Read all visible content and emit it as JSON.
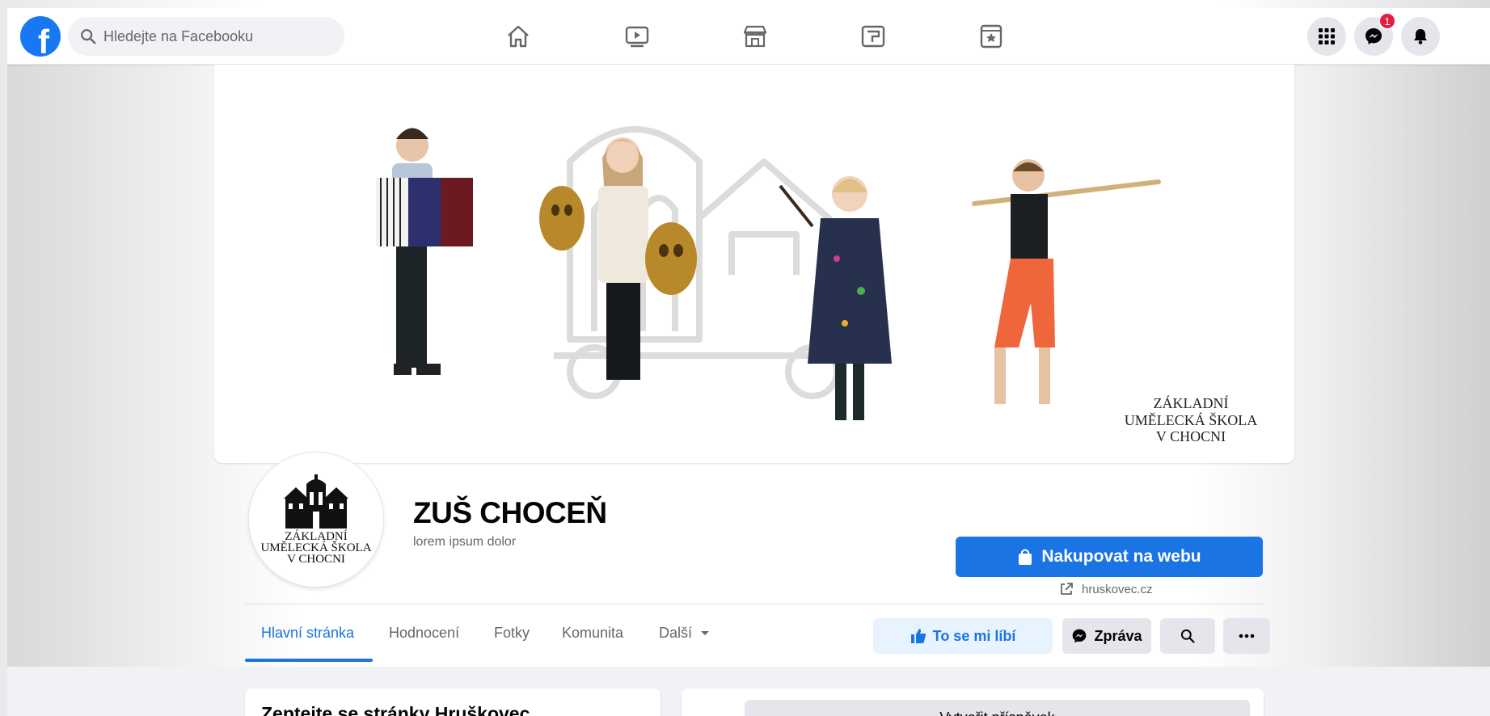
{
  "topbar": {
    "logo_icon": "facebook-logo-icon",
    "logo_letter": "f",
    "search_placeholder": "Hledejte na Facebooku",
    "nav_icons": [
      "home-icon",
      "watch-icon",
      "marketplace-icon",
      "groups-icon",
      "gaming-icon"
    ],
    "right_icons": [
      "menu-grid-icon",
      "messenger-icon",
      "notifications-bell-icon"
    ],
    "messenger_badge": "1"
  },
  "cover": {
    "logo_lines": [
      "ZÁKLADNÍ",
      "UMĚLECKÁ ŠKOLA",
      "V CHOCNI"
    ]
  },
  "profile": {
    "avatar_lines": [
      "ZÁKLADNÍ",
      "UMĚLECKÁ ŠKOLA",
      "V CHOCNI"
    ],
    "name": "ZUŠ CHOCEŇ",
    "subtitle": "lorem ipsum dolor",
    "shop_button": "Nakupovat na webu",
    "website": "hruskovec.cz"
  },
  "tabs": [
    {
      "label": "Hlavní stránka",
      "active": true
    },
    {
      "label": "Hodnocení",
      "active": false
    },
    {
      "label": "Fotky",
      "active": false
    },
    {
      "label": "Komunita",
      "active": false
    },
    {
      "label": "Další",
      "active": false
    }
  ],
  "actions": {
    "like": "To se mi líbí",
    "message": "Zpráva"
  },
  "left_card": {
    "title": "Zeptejte se stránky Hruškovec"
  },
  "right_card": {
    "create_post": "Vytvořit příspěvek"
  },
  "colors": {
    "brand": "#1877f2",
    "button_blue": "#1b74e4",
    "badge_red": "#e41e3f"
  }
}
